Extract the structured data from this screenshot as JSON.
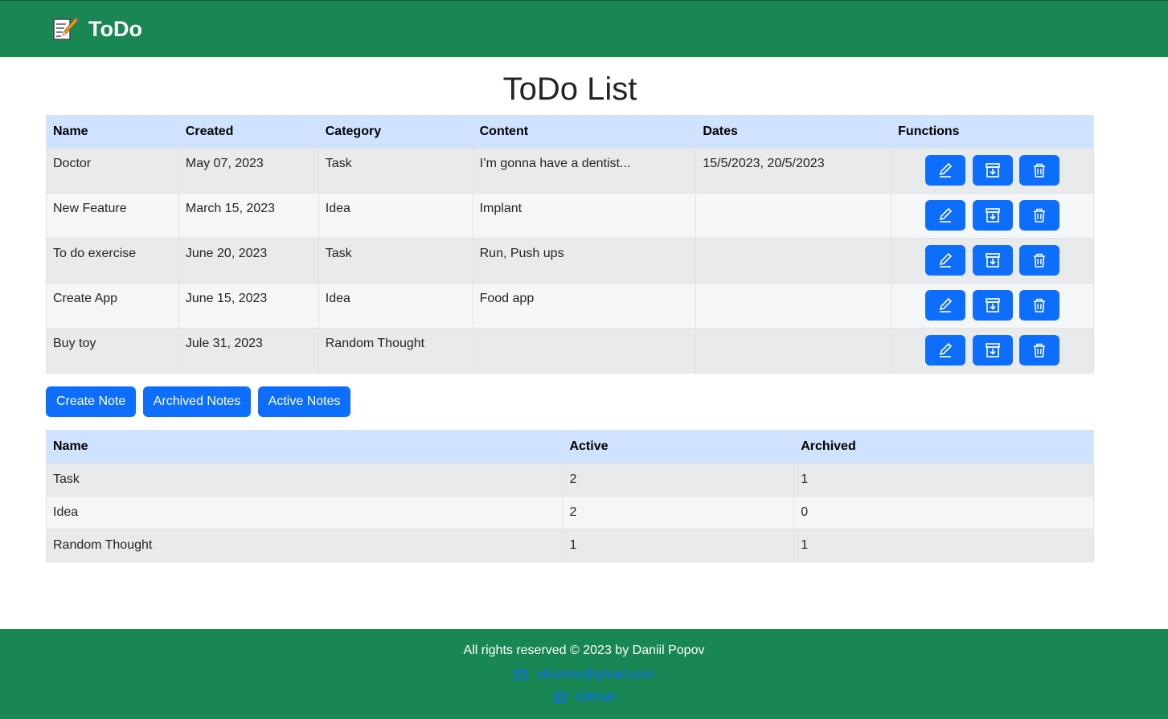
{
  "brand": {
    "name": "ToDo",
    "icon": "memo-pencil-icon"
  },
  "page_title": "ToDo List",
  "notes_table": {
    "headers": [
      "Name",
      "Created",
      "Category",
      "Content",
      "Dates",
      "Functions"
    ],
    "rows": [
      {
        "name": "Doctor",
        "created": "May 07, 2023",
        "category": "Task",
        "content": "I’m gonna have a dentist...",
        "dates": "15/5/2023, 20/5/2023"
      },
      {
        "name": "New Feature",
        "created": "March 15, 2023",
        "category": "Idea",
        "content": "Implant",
        "dates": ""
      },
      {
        "name": "To do exercise",
        "created": "June 20, 2023",
        "category": "Task",
        "content": "Run, Push ups",
        "dates": ""
      },
      {
        "name": "Create App",
        "created": "June 15, 2023",
        "category": "Idea",
        "content": "Food app",
        "dates": ""
      },
      {
        "name": "Buy toy",
        "created": "Jule 31, 2023",
        "category": "Random Thought",
        "content": "",
        "dates": ""
      }
    ],
    "function_icons": [
      "edit-icon",
      "archive-icon",
      "trash-icon"
    ]
  },
  "actions": {
    "create": "Create Note",
    "archived": "Archived Notes",
    "active": "Active Notes"
  },
  "stats_table": {
    "headers": [
      "Name",
      "Active",
      "Archived"
    ],
    "rows": [
      {
        "name": "Task",
        "active": "2",
        "archived": "1"
      },
      {
        "name": "Idea",
        "active": "2",
        "archived": "0"
      },
      {
        "name": "Random Thought",
        "active": "1",
        "archived": "1"
      }
    ]
  },
  "footer": {
    "text": "All rights reserved © 2023 by Daniil Popov",
    "email": "x6uhrox@gmail.com",
    "github": "GitHub"
  },
  "colors": {
    "navbar": "#198754",
    "primary": "#0d6efd",
    "header_row": "#cfe2ff"
  }
}
